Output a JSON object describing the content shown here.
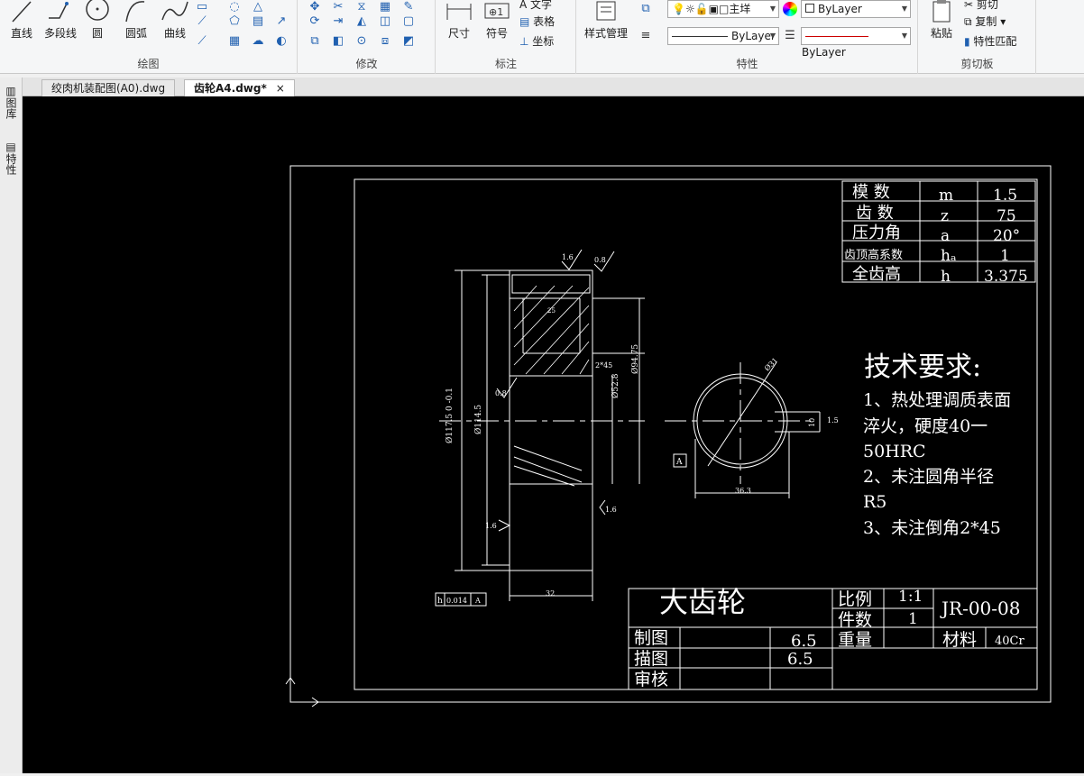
{
  "ribbon": {
    "draw_panel": {
      "title": "绘图",
      "tools": [
        "直线",
        "多段线",
        "圆",
        "圆弧",
        "曲线"
      ]
    },
    "modify_panel": {
      "title": "修改"
    },
    "annotation_panel": {
      "title": "标注",
      "tools": [
        "尺寸",
        "符号"
      ],
      "small": [
        "文字",
        "表格",
        "坐标"
      ]
    },
    "properties_panel": {
      "title": "特性",
      "style_manager": "样式管理",
      "layer_name": "主垟",
      "color_value": "ByLayer",
      "linetype_value": "ByLayer",
      "lineweight_value": "ByLayer"
    },
    "clipboard_panel": {
      "title": "剪切板",
      "paste": "粘贴",
      "cut": "剪切",
      "copy": "复制",
      "match": "特性匹配"
    }
  },
  "tabs": [
    {
      "label": "绞肉机装配图(A0).dwg"
    },
    {
      "label": "齿轮A4.dwg*",
      "close": "×"
    }
  ],
  "side_panel": {
    "items": [
      "图库",
      "特性"
    ]
  },
  "drawing": {
    "params": [
      {
        "name": "模 数",
        "symbol": "m",
        "value": "1.5"
      },
      {
        "name": "齿 数",
        "symbol": "z",
        "value": "75"
      },
      {
        "name": "压力角",
        "symbol": "a",
        "value": "20°"
      },
      {
        "name": "齿顶高系数",
        "symbol": "hₐ",
        "value": "1"
      },
      {
        "name": "全齿高",
        "symbol": "h",
        "value": "3.375"
      }
    ],
    "tech_title": "技术要求:",
    "tech_lines": [
      "1、热处理调质表面",
      "淬火，硬度40一",
      "50HRC",
      "2、未注圆角半径",
      "R5",
      "3、未注倒角2*45"
    ],
    "dims": {
      "od_left": "Ø117.5 0 -0.1",
      "bore_left": "Ø114.5",
      "hub_d": "Ø52.8",
      "pitch": "Ø94.75",
      "chamfer": "2*45",
      "width_top": "25",
      "width_bottom": "32",
      "rough_top1": "1.6",
      "rough_top2": "0.8",
      "rough_left": "0.8",
      "rough_mid": "1.6",
      "rough_right": "1.6",
      "tol_sym": "h",
      "tol_val": "0.014",
      "tol_ref": "A",
      "circle_d": "Ø31",
      "keyway_w": "10",
      "keyway_depth": "1.5",
      "keyway_total": "36.3",
      "datum": "A"
    },
    "titleblock": {
      "part_name": "大齿轮",
      "scale_label": "比例",
      "scale_value": "1:1",
      "count_label": "件数",
      "count_value": "1",
      "code": "JR-00-08",
      "weight_label": "重量",
      "material_label": "材料",
      "material_value": "40Cr",
      "drawn_label": "制图",
      "drawn_value": "6.5",
      "traced_label": "描图",
      "traced_value": "6.5",
      "review_label": "审核"
    }
  }
}
